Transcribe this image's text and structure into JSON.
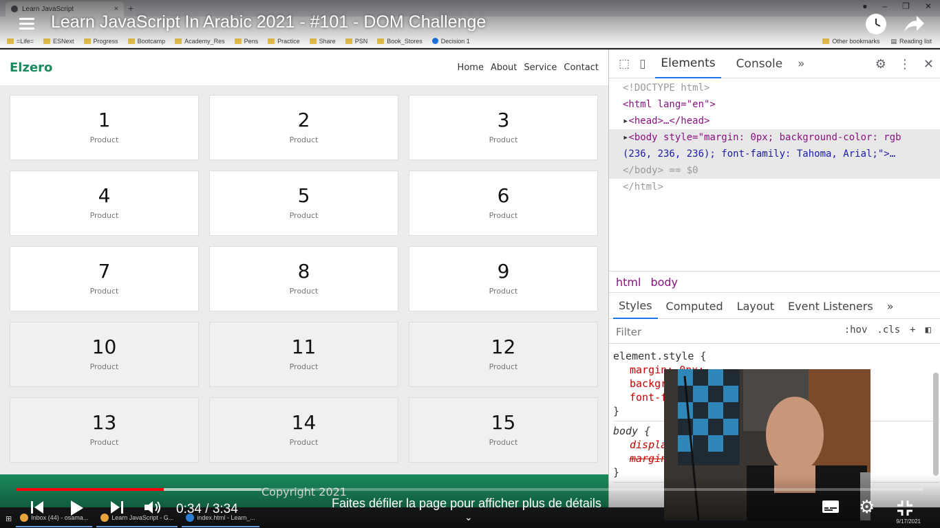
{
  "browser": {
    "tab_title": "Learn JavaScript",
    "tab_close": "×",
    "new_tab": "+",
    "bookmarks": [
      "=Life=",
      "ESNext",
      "Progress",
      "Bootcamp",
      "Academy_Res",
      "Pens",
      "Practice",
      "Share",
      "PSN",
      "Book_Stores",
      "Decision 1"
    ],
    "other_bookmarks": "Other bookmarks",
    "reading_list": "Reading list"
  },
  "site": {
    "logo": "Elzero",
    "nav": [
      "Home",
      "About",
      "Service",
      "Contact"
    ],
    "cards": [
      {
        "num": "1",
        "label": "Product"
      },
      {
        "num": "2",
        "label": "Product"
      },
      {
        "num": "3",
        "label": "Product"
      },
      {
        "num": "4",
        "label": "Product"
      },
      {
        "num": "5",
        "label": "Product"
      },
      {
        "num": "6",
        "label": "Product"
      },
      {
        "num": "7",
        "label": "Product"
      },
      {
        "num": "8",
        "label": "Product"
      },
      {
        "num": "9",
        "label": "Product"
      },
      {
        "num": "10",
        "label": "Product"
      },
      {
        "num": "11",
        "label": "Product"
      },
      {
        "num": "12",
        "label": "Product"
      },
      {
        "num": "13",
        "label": "Product"
      },
      {
        "num": "14",
        "label": "Product"
      },
      {
        "num": "15",
        "label": "Product"
      }
    ],
    "footer": "Copyright 2021"
  },
  "devtools": {
    "tabs": [
      "Elements",
      "Console"
    ],
    "more": "»",
    "dom": {
      "doctype": "<!DOCTYPE html>",
      "html_open": "<html lang=\"en\">",
      "head": "<head>…</head>",
      "body_open": "<body style=\"margin: 0px; background-color: rgb",
      "body_cont": "(236, 236, 236); font-family: Tahoma, Arial;\">…",
      "body_close": "</body> == $0",
      "html_close": "</html>"
    },
    "breadcrumbs": [
      "html",
      "body"
    ],
    "sub_tabs": [
      "Styles",
      "Computed",
      "Layout",
      "Event Listeners"
    ],
    "filter_placeholder": "Filter",
    "filter_tools": [
      ":hov",
      ".cls",
      "+"
    ],
    "styles": {
      "rule1_selector": "element.style {",
      "rule1_props": [
        "margin: 0px;",
        "background-color: rgb(236, 236, 236);",
        "font-family: Tahoma, Arial;"
      ],
      "rule2_selector": "body {",
      "rule2_props": [
        "display: block;",
        "margin: 8px;"
      ],
      "close": "}"
    }
  },
  "video": {
    "title": "Learn JavaScript In Arabic 2021 - #101 - DOM Challenge",
    "time": "0:34 / 3:34",
    "progress": 0.162,
    "buffered": 0.27,
    "scroll_hint": "Faites défiler la page pour afficher plus de détails",
    "accent": "#ff0000"
  },
  "taskbar": {
    "items": [
      "Inbox (44) - osama...",
      "Learn JavaScript - G...",
      "index.html - Learn_..."
    ],
    "date": "9/17/2021"
  },
  "colors": {
    "brand": "#1a8a5c",
    "devtools_accent": "#1a73e8"
  }
}
